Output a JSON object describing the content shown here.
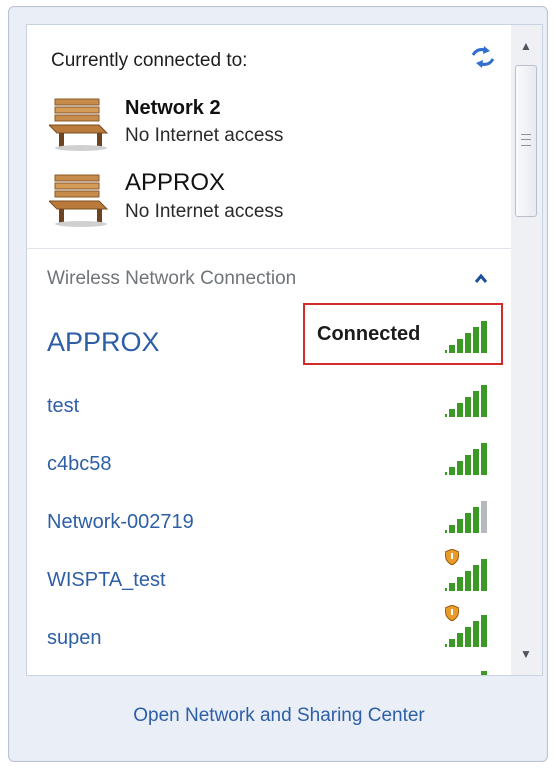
{
  "currently_connected": {
    "title": "Currently connected to:",
    "networks": [
      {
        "name": "Network  2",
        "status": "No Internet access",
        "icon": "bench-network-icon"
      },
      {
        "name": "APPROX",
        "status": "No Internet access",
        "icon": "bench-network-icon"
      }
    ]
  },
  "wireless": {
    "section_title": "Wireless Network Connection",
    "connected_label": "Connected",
    "items": [
      {
        "name": "APPROX",
        "signal_bars": 5,
        "secured": true
      },
      {
        "name": "test",
        "signal_bars": 5,
        "secured": true
      },
      {
        "name": "c4bc58",
        "signal_bars": 5,
        "secured": true
      },
      {
        "name": "Network-002719",
        "signal_bars": 4,
        "secured": true
      },
      {
        "name": "WISPTA_test",
        "signal_bars": 5,
        "secured": false
      },
      {
        "name": "supen",
        "signal_bars": 5,
        "secured": false
      }
    ]
  },
  "footer": {
    "link": "Open Network and Sharing Center"
  },
  "colors": {
    "link": "#2e5fa6",
    "signal": "#3a9a25",
    "highlight_box": "#d42a2a"
  }
}
